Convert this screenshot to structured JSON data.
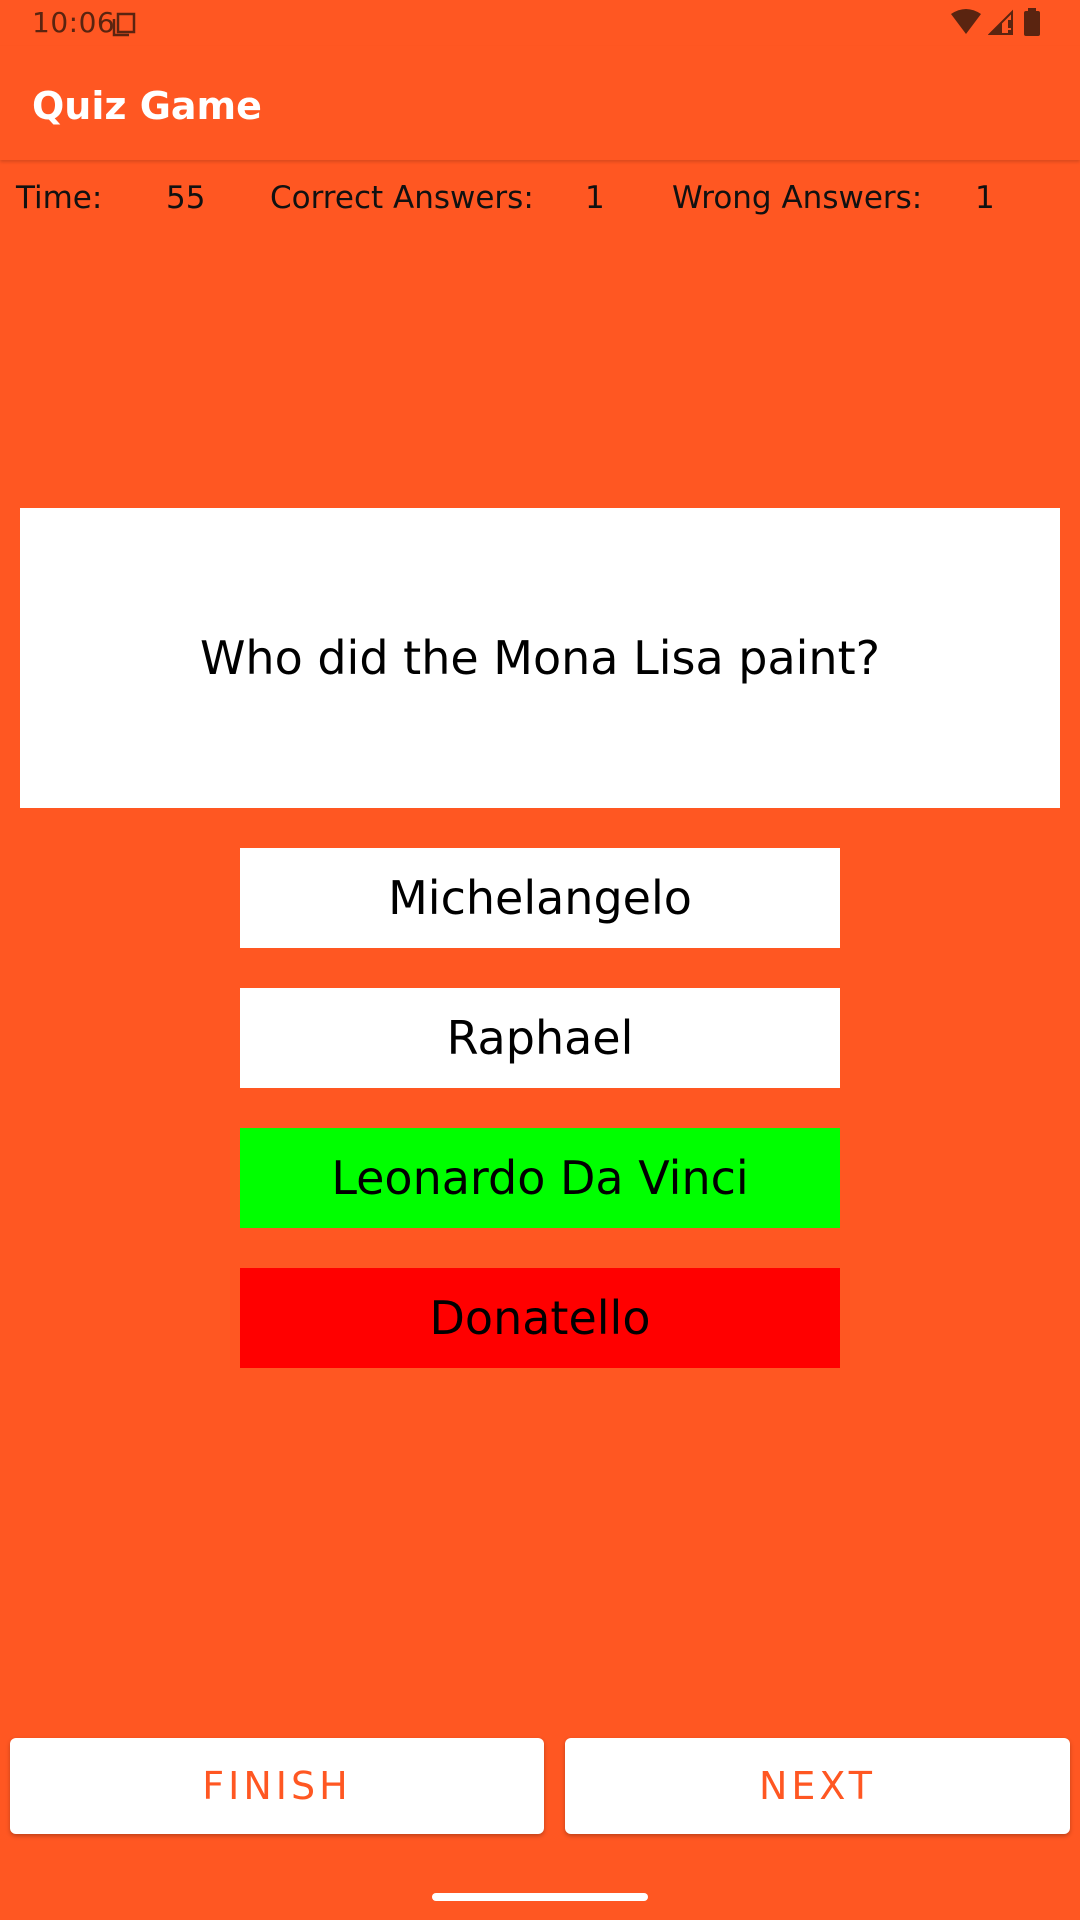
{
  "status_bar": {
    "time": "10:06",
    "icons": [
      "screenshot-icon",
      "wifi-icon",
      "signal-icon",
      "battery-icon"
    ]
  },
  "app_bar": {
    "title": "Quiz Game"
  },
  "stats": {
    "time_label": "Time:",
    "time_value": "55",
    "correct_label": "Correct Answers:",
    "correct_value": "1",
    "wrong_label": "Wrong Answers:",
    "wrong_value": "1"
  },
  "question": {
    "text": "Who did the Mona Lisa paint?"
  },
  "answers": [
    {
      "label": "Michelangelo",
      "state": "neutral",
      "color": "#FFFFFF"
    },
    {
      "label": "Raphael",
      "state": "neutral",
      "color": "#FFFFFF"
    },
    {
      "label": "Leonardo Da Vinci",
      "state": "correct",
      "color": "#00FF00"
    },
    {
      "label": "Donatello",
      "state": "wrong",
      "color": "#FF0000"
    }
  ],
  "buttons": {
    "finish_label": "FINISH",
    "next_label": "NEXT"
  },
  "colors": {
    "background": "#FF5722",
    "button_text": "#FF5722",
    "card": "#FFFFFF"
  }
}
